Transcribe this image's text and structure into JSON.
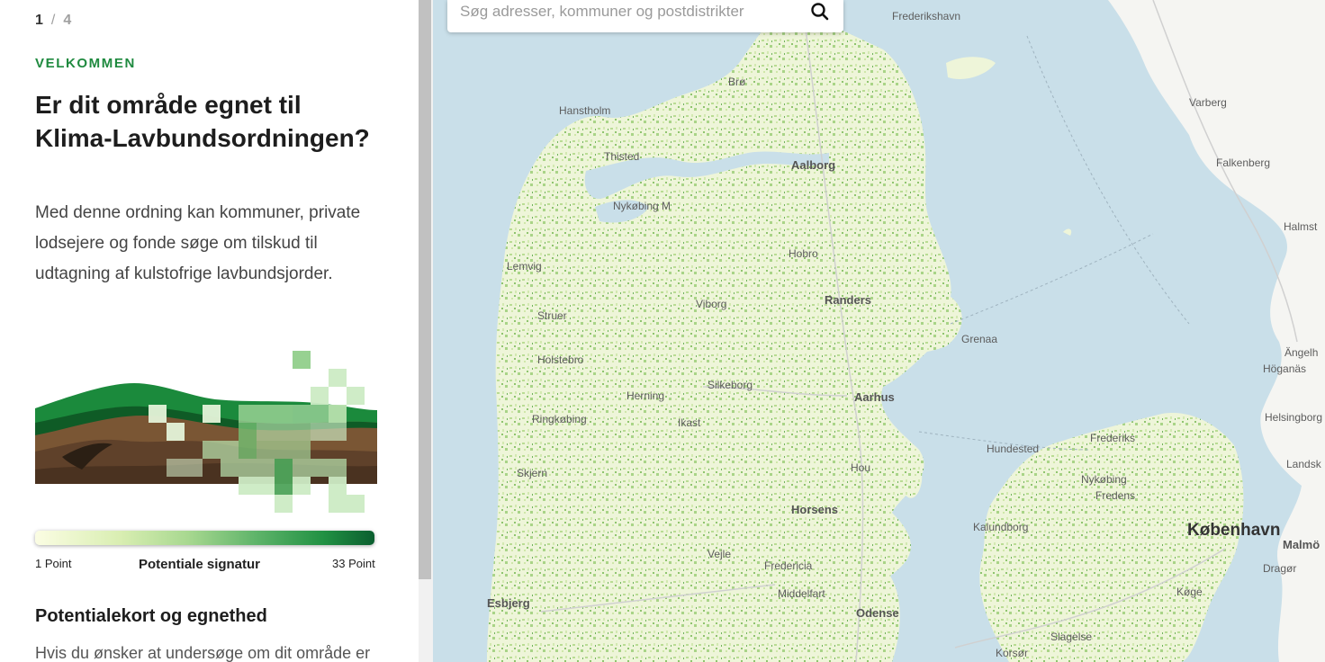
{
  "pager": {
    "current": "1",
    "separator": "/",
    "total": "4"
  },
  "intro": {
    "kicker": "VELKOMMEN",
    "headline": "Er dit område egnet til Klima-Lavbundsordningen?",
    "text": "Med denne ordning kan kommuner, private lodsejere og fonde søge om tilskud til udtagning af kulstofrige lavbundsjorder."
  },
  "legend": {
    "min_label": "1 Point",
    "title": "Potentiale signatur",
    "max_label": "33 Point",
    "min_value": 1,
    "max_value": 33,
    "colors": [
      "#fbfde3",
      "#d9eeb2",
      "#a8d890",
      "#5fb46a",
      "#219143",
      "#0b5e2f"
    ]
  },
  "section": {
    "title": "Potentialekort og egnethed",
    "text": "Hvis du ønsker at undersøge om dit område er"
  },
  "search": {
    "placeholder": "Søg adresser, kommuner og postdistrikter",
    "icon": "search-icon"
  },
  "map": {
    "water_color": "#c9dfe9",
    "land_color": "#f4f4ef",
    "places": {
      "frederikshavn": "Frederikshavn",
      "hanstholm": "Hanstholm",
      "aalborg": "Aalborg",
      "nykobing_mors": "Nykøbing M",
      "hobro": "Hobro",
      "randers": "Randers",
      "viborg": "Viborg",
      "grenaa": "Grenaa",
      "struer": "Struer",
      "holstebro": "Holstebro",
      "silkeborg": "Silkeborg",
      "aarhus": "Aarhus",
      "herning": "Herning",
      "ikast": "Ikast",
      "skjern": "Skjern",
      "horsens": "Horsens",
      "vejle": "Vejle",
      "fredericia": "Fredericia",
      "esbjerg": "Esbjerg",
      "middelfart": "Middelfart",
      "odense": "Odense",
      "korsor": "Korsør",
      "slagelse": "Slagelse",
      "hundested": "Hundested",
      "frederikssund": "Frederikssund",
      "frederiksværk": "Frederiks",
      "nykobing_sj": "Nykøbing",
      "fredensborg": "Fredens",
      "kobenhavn": "København",
      "malmo": "Malmö",
      "koge": "Køge",
      "dragor": "Dragør",
      "kalundborg": "Kalundborg",
      "varberg": "Varberg",
      "falkenberg": "Falkenberg",
      "halmstad": "Halmst",
      "angelholm": "Ängelh",
      "hoganas": "Höganäs",
      "helsingborg": "Helsingborg",
      "landskrona": "Landsk",
      "horsens_fjord": "Hou",
      "bronderslev": "Brø",
      "thisted": "Thisted",
      "lemvig": "Lemvig",
      "ringkobing": "Ringkøbing"
    }
  }
}
